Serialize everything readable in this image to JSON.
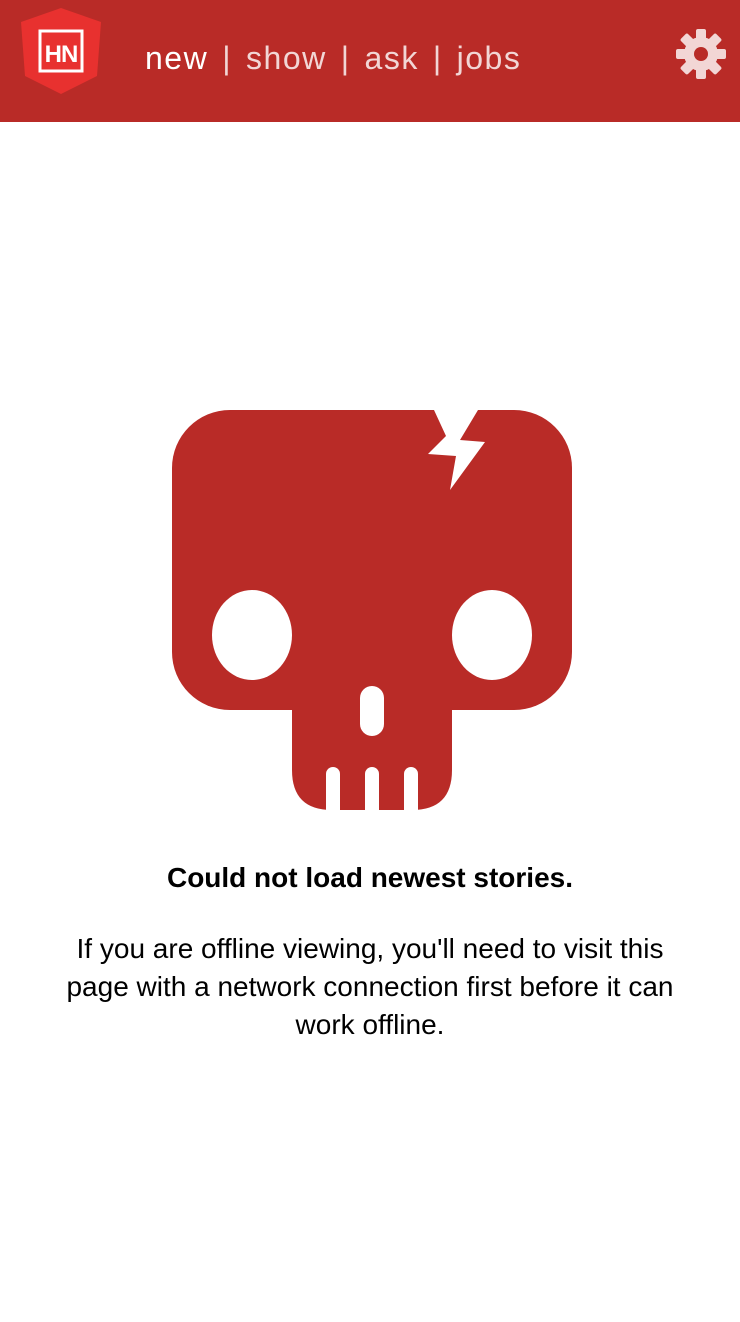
{
  "header": {
    "logo_text": "HN",
    "nav": {
      "new": "new",
      "show": "show",
      "ask": "ask",
      "jobs": "jobs",
      "separator": "|"
    },
    "settings_icon": "gear-icon"
  },
  "main": {
    "illustration_icon": "skull-icon",
    "error_title": "Could not load newest stories.",
    "error_message": "If you are offline viewing, you'll need to visit this page with a network connection first before it can work offline."
  },
  "colors": {
    "brand": "#b92b27",
    "logo": "#e8312f",
    "text": "#000000",
    "background": "#ffffff"
  }
}
